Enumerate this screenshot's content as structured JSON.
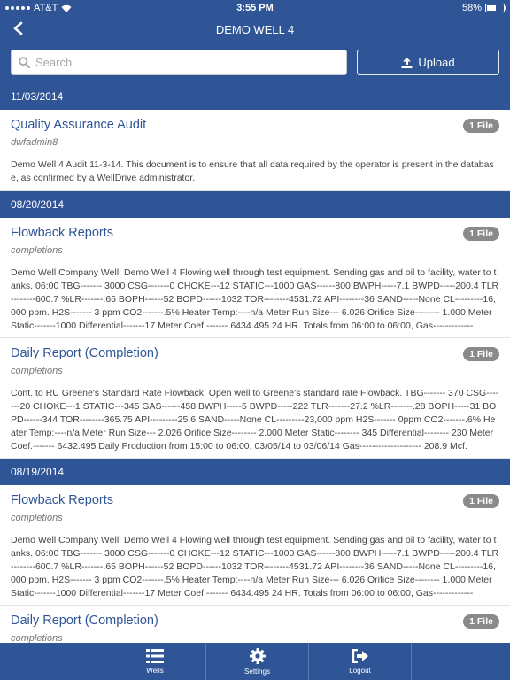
{
  "status_bar": {
    "carrier": "AT&T",
    "time": "3:55 PM",
    "battery": "58%",
    "battery_level": 0.58
  },
  "nav": {
    "title": "DEMO WELL 4"
  },
  "search": {
    "placeholder": "Search"
  },
  "upload": {
    "label": "Upload"
  },
  "sections": [
    {
      "date": "11/03/2014",
      "items": [
        {
          "title": "Quality Assurance Audit",
          "author": "dwfadmin8",
          "badge": "1 File",
          "description": "Demo Well 4 Audit 11-3-14. This document is to ensure that all data required by the operator is present in the database, as confirmed by a WellDrive administrator."
        }
      ]
    },
    {
      "date": "08/20/2014",
      "items": [
        {
          "title": "Flowback Reports",
          "author": "completions",
          "badge": "1 File",
          "description": "Demo Well Company Well: Demo Well 4 Flowing well through test equipment. Sending gas and oil to facility, water to tanks. 06:00 TBG------- 3000 CSG-------0 CHOKE---12 STATIC---1000 GAS------800 BWPH-----7.1 BWPD-----200.4 TLR--------600.7 %LR-------.65 BOPH------52 BOPD------1032 TOR--------4531.72 API--------36 SAND-----None CL---------16,000 ppm. H2S------- 3 ppm CO2-------.5% Heater Temp:----n/a Meter Run Size--- 6.026 Orifice Size-------- 1.000 Meter Static-------1000 Differential-------17 Meter Coef.------- 6434.495 24 HR. Totals from 06:00 to 06:00, Gas-------------"
        },
        {
          "title": "Daily Report (Completion)",
          "author": "completions",
          "badge": "1 File",
          "description": "Cont. to RU Greene's Standard Rate Flowback, Open well to Greene's standard rate Flowback. TBG------- 370 CSG-------20 CHOKE---1 STATIC---345 GAS------458 BWPH-----5 BWPD-----222 TLR-------27.2 %LR-------.28 BOPH-----31 BOPD------344 TOR--------365.75 API---------25.6 SAND-----None CL---------23,000 ppm H2S------- 0ppm CO2-------.6% Heater Temp:----n/a Meter Run Size--- 2.026 Orifice Size-------- 2.000 Meter Static-------- 345 Differential-------- 230 Meter Coef.------- 6432.495 Daily Production from 15:00 to 06:00, 03/05/14 to 03/06/14 Gas-------------------- 208.9 Mcf."
        }
      ]
    },
    {
      "date": "08/19/2014",
      "items": [
        {
          "title": "Flowback Reports",
          "author": "completions",
          "badge": "1 File",
          "description": "Demo Well Company Well: Demo Well 4 Flowing well through test equipment. Sending gas and oil to facility, water to tanks. 06:00 TBG------- 3000 CSG-------0 CHOKE---12 STATIC---1000 GAS------800 BWPH-----7.1 BWPD-----200.4 TLR--------600.7 %LR-------.65 BOPH------52 BOPD------1032 TOR--------4531.72 API--------36 SAND-----None CL---------16,000 ppm. H2S------- 3 ppm CO2-------.5% Heater Temp:----n/a Meter Run Size--- 6.026 Orifice Size-------- 1.000 Meter Static-------1000 Differential-------17 Meter Coef.------- 6434.495 24 HR. Totals from 06:00 to 06:00, Gas-------------"
        },
        {
          "title": "Daily Report (Completion)",
          "author": "completions",
          "badge": "1 File",
          "description": ""
        }
      ]
    }
  ],
  "tabs": [
    {
      "label": "Wells",
      "icon": "list-icon"
    },
    {
      "label": "Settings",
      "icon": "gear-icon"
    },
    {
      "label": "Logout",
      "icon": "logout-icon"
    }
  ]
}
